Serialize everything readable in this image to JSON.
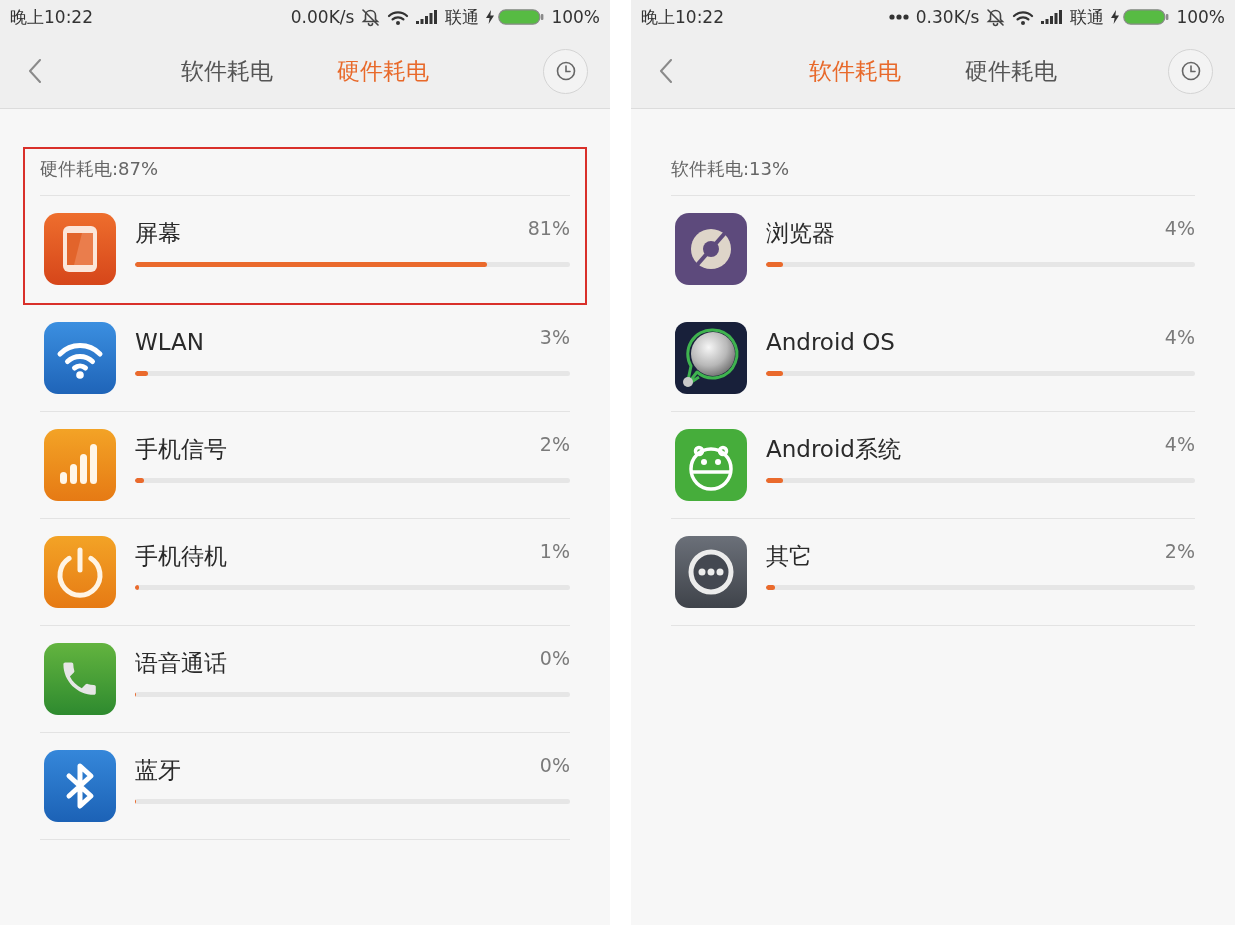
{
  "screens": [
    {
      "status_bar": {
        "time": "晚上10:22",
        "notification_dots": false,
        "speed": "0.00K/s",
        "carrier": "联通",
        "charging": true,
        "battery": "100%"
      },
      "header": {
        "tabs": [
          {
            "label": "软件耗电",
            "selected": false
          },
          {
            "label": "硬件耗电",
            "selected": true
          }
        ]
      },
      "framed": true,
      "summary": "硬件耗电:87%",
      "items": [
        {
          "kind": "screen",
          "name": "屏幕",
          "reading": "81%",
          "level": 0.81
        },
        {
          "kind": "wifi",
          "name": "WLAN",
          "reading": "3%",
          "level": 0.03
        },
        {
          "kind": "signal",
          "name": "手机信号",
          "reading": "2%",
          "level": 0.02
        },
        {
          "kind": "standby",
          "name": "手机待机",
          "reading": "1%",
          "level": 0.01
        },
        {
          "kind": "call",
          "name": "语音通话",
          "reading": "0%",
          "level": 0
        },
        {
          "kind": "bluetooth",
          "name": "蓝牙",
          "reading": "0%",
          "level": 0
        }
      ]
    },
    {
      "status_bar": {
        "time": "晚上10:22",
        "notification_dots": true,
        "speed": "0.30K/s",
        "carrier": "联通",
        "charging": true,
        "battery": "100%"
      },
      "header": {
        "tabs": [
          {
            "label": "软件耗电",
            "selected": true
          },
          {
            "label": "硬件耗电",
            "selected": false
          }
        ]
      },
      "framed": false,
      "summary": "软件耗电:13%",
      "items": [
        {
          "kind": "browser",
          "name": "浏览器",
          "reading": "4%",
          "level": 0.04
        },
        {
          "kind": "android_os",
          "name": "Android OS",
          "reading": "4%",
          "level": 0.04
        },
        {
          "kind": "android_system",
          "name": "Android系统",
          "reading": "4%",
          "level": 0.04
        },
        {
          "kind": "other",
          "name": "其它",
          "reading": "2%",
          "level": 0.02
        }
      ]
    }
  ]
}
